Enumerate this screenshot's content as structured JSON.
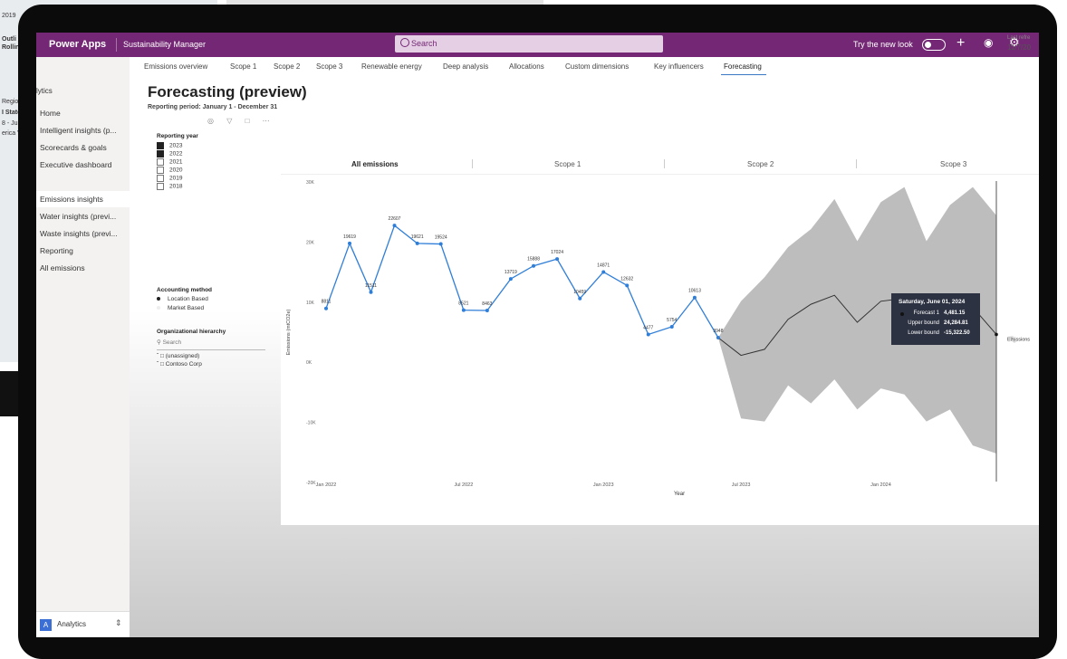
{
  "background": {
    "left_fragments": [
      "2019",
      "Outli",
      "Rollin",
      "Regior",
      "I State",
      "8 - Jun",
      "erica V"
    ]
  },
  "appbar": {
    "brand": "Power Apps",
    "app_name": "Sustainability Manager",
    "search_placeholder": "Search",
    "try_new_look": "Try the new look",
    "color": "#742774"
  },
  "nav": {
    "section_title": "lytics",
    "items": [
      {
        "label": "Home"
      },
      {
        "label": "Intelligent insights (p..."
      },
      {
        "label": "Scorecards & goals"
      },
      {
        "label": "Executive dashboard"
      },
      {
        "label": "Emissions insights"
      },
      {
        "label": "Water insights (previ..."
      },
      {
        "label": "Waste insights (previ..."
      },
      {
        "label": "Reporting"
      },
      {
        "label": "All emissions"
      }
    ],
    "active_index": 4,
    "footer": {
      "badge": "A",
      "label": "Analytics"
    }
  },
  "tabs": {
    "items": [
      "Emissions overview",
      "Scope 1",
      "Scope 2",
      "Scope 3",
      "Renewable energy",
      "Deep analysis",
      "Allocations",
      "Custom dimensions",
      "Key influencers",
      "Forecasting"
    ],
    "active_index": 9,
    "last_refresh_label": "Last refre",
    "last_refresh_value": "11/7/20"
  },
  "page": {
    "title": "Forecasting (preview)",
    "reporting_period": "Reporting period: January 1 - December 31"
  },
  "filters": {
    "reporting_year_title": "Reporting year",
    "years": [
      {
        "label": "2023",
        "checked": true
      },
      {
        "label": "2022",
        "checked": true
      },
      {
        "label": "2021",
        "checked": false
      },
      {
        "label": "2020",
        "checked": false
      },
      {
        "label": "2019",
        "checked": false
      },
      {
        "label": "2018",
        "checked": false
      }
    ],
    "accounting_title": "Accounting method",
    "methods": [
      {
        "label": "Location Based",
        "selected": true
      },
      {
        "label": "Market Based",
        "selected": false
      }
    ],
    "org_title": "Organizational hierarchy",
    "org_search_placeholder": "Search",
    "org_nodes": [
      "(unassigned)",
      "Contoso Corp"
    ]
  },
  "chart_tabs": [
    "All emissions",
    "Scope 1",
    "Scope 2",
    "Scope 3"
  ],
  "chart_tabs_active": 0,
  "tooltip": {
    "date": "Saturday, June 01, 2024",
    "rows": [
      {
        "label": "Forecast 1",
        "value": "4,481.15"
      },
      {
        "label": "Upper bound",
        "value": "24,284.81"
      },
      {
        "label": "Lower bound",
        "value": "-15,322.50"
      }
    ]
  },
  "chart_data": {
    "type": "line",
    "xlabel": "Year",
    "ylabel": "Emissions (mtCO2e)",
    "y_ticks": [
      "30K",
      "20K",
      "10K",
      "0K",
      "-10K",
      "-20K"
    ],
    "ylim": [
      -20000,
      30000
    ],
    "x_ticks": [
      "Jan 2022",
      "Jul 2022",
      "Jan 2023",
      "Jul 2023",
      "Jan 2024"
    ],
    "series": [
      {
        "name": "Emissions",
        "color": "#2f7ed8",
        "x": [
          "2022-01",
          "2022-02",
          "2022-03",
          "2022-04",
          "2022-05",
          "2022-06",
          "2022-07",
          "2022-08",
          "2022-09",
          "2022-10",
          "2022-11",
          "2022-12",
          "2023-01",
          "2023-02",
          "2023-03",
          "2023-04",
          "2023-05",
          "2023-06",
          "2023-07",
          "2023-08",
          "2023-09",
          "2023-10"
        ],
        "values": [
          8811,
          19619,
          11511,
          22607,
          19621,
          19524,
          8521,
          8463,
          13719,
          15888,
          17024,
          10459,
          14871,
          12632,
          4477,
          5754,
          10613,
          3948,
          3948,
          3948,
          3948,
          3948
        ],
        "labels": [
          "8811",
          "19619",
          "11511",
          "22607",
          "19621",
          "19524",
          "8521",
          "8463",
          "13719",
          "15888",
          "17024",
          "10459",
          "14871",
          "12632",
          "4477",
          "5754",
          "10613",
          "3948",
          null,
          null,
          null,
          null
        ]
      }
    ],
    "forecast": {
      "name": "Forecast 1",
      "color": "#333333",
      "band_color": "#bdbdbd",
      "x": [
        "2023-06",
        "2023-07",
        "2023-08",
        "2023-09",
        "2023-10",
        "2023-11",
        "2023-12",
        "2024-01",
        "2024-02",
        "2024-03",
        "2024-04",
        "2024-05",
        "2024-06"
      ],
      "values": [
        3948,
        1000,
        2000,
        7000,
        9500,
        11000,
        6500,
        10000,
        10500,
        5500,
        7500,
        9000,
        4481
      ],
      "upper": [
        3948,
        10000,
        14000,
        19000,
        22000,
        27000,
        20000,
        26500,
        29000,
        20000,
        26000,
        29000,
        24285
      ],
      "lower": [
        3948,
        -9500,
        -10000,
        -4000,
        -7000,
        -3000,
        -8000,
        -4500,
        -5500,
        -10000,
        -8000,
        -14000,
        -15322
      ]
    },
    "end_label": "Emissions",
    "grid": false,
    "legend": "none"
  }
}
